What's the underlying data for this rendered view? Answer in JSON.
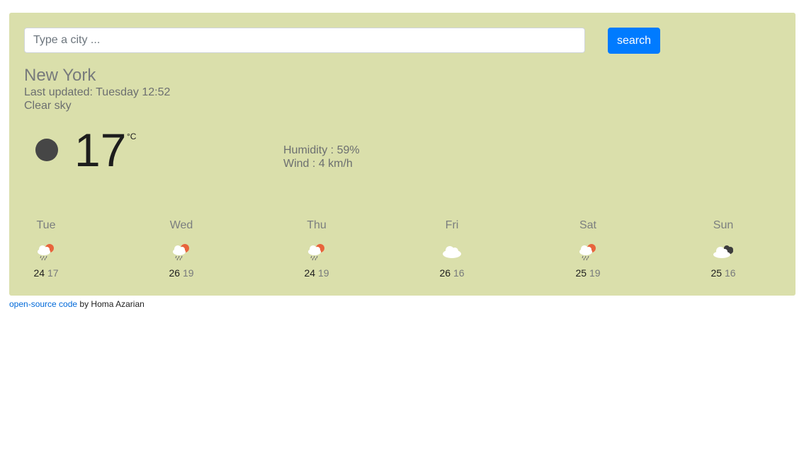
{
  "search": {
    "placeholder": "Type a city ...",
    "value": "",
    "button_label": "search"
  },
  "current": {
    "city": "New York",
    "last_updated": "Last updated: Tuesday 12:52",
    "description": "Clear sky",
    "icon": "clear-night-icon",
    "temperature": "17",
    "unit": "°C",
    "humidity": "Humidity : 59%",
    "wind": "Wind : 4 km/h"
  },
  "forecast": [
    {
      "day": "Tue",
      "icon": "rain-sun-icon",
      "max": "24",
      "min": "17"
    },
    {
      "day": "Wed",
      "icon": "rain-sun-icon",
      "max": "26",
      "min": "19"
    },
    {
      "day": "Thu",
      "icon": "rain-sun-icon",
      "max": "24",
      "min": "19"
    },
    {
      "day": "Fri",
      "icon": "cloud-icon",
      "max": "26",
      "min": "16"
    },
    {
      "day": "Sat",
      "icon": "rain-sun-icon",
      "max": "25",
      "min": "19"
    },
    {
      "day": "Sun",
      "icon": "broken-clouds-icon",
      "max": "25",
      "min": "16"
    }
  ],
  "footer": {
    "link_text": "open-source code",
    "author": "by Homa Azarian"
  },
  "colors": {
    "card_background": "#dadfab",
    "button": "#007bff",
    "link": "#0069d9"
  }
}
